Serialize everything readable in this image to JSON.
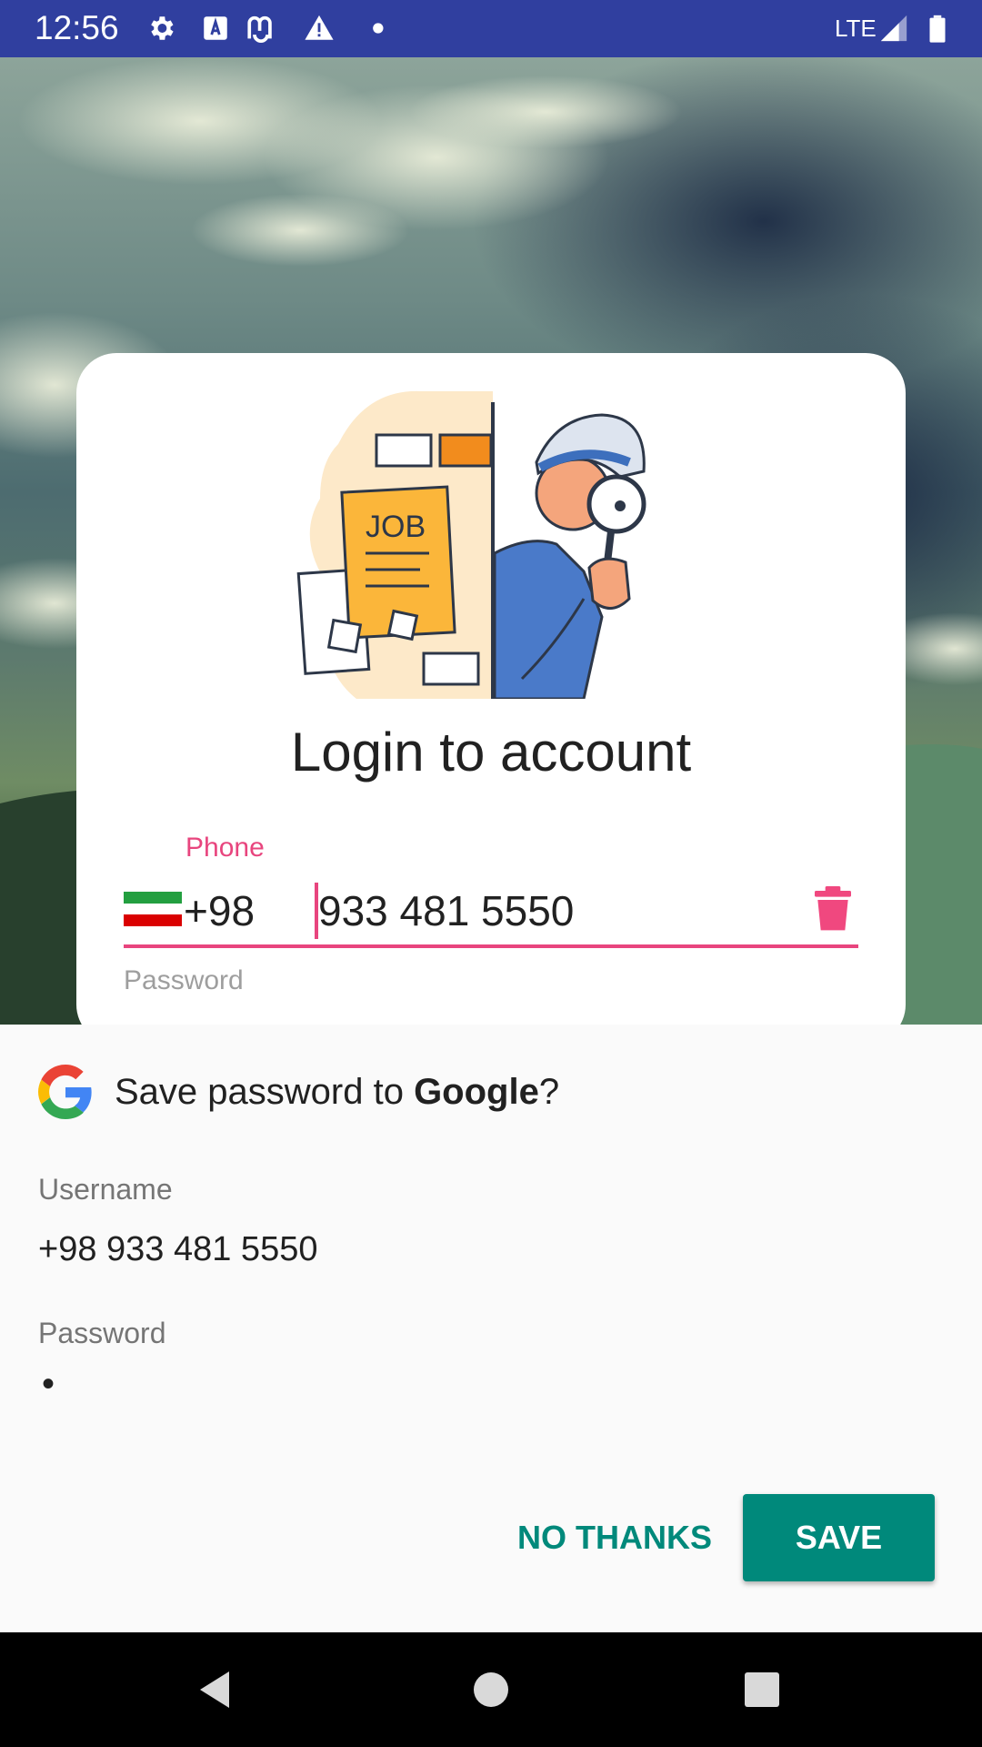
{
  "status_bar": {
    "time": "12:56",
    "network": "LTE",
    "icons": [
      "settings-icon",
      "a-box-icon",
      "m-app-icon",
      "warning-icon",
      "dot-icon",
      "signal-icon",
      "battery-icon"
    ],
    "background_color": "#303f9f"
  },
  "login": {
    "title": "Login to account",
    "phone_label": "Phone",
    "country_code": "+98",
    "phone_number": "933 481 5550",
    "password_label": "Password",
    "illustration_text": "JOB",
    "accent_color": "#e8457e",
    "flag_colors": [
      "#239f40",
      "#ffffff",
      "#da0000"
    ]
  },
  "save_sheet": {
    "title_prefix": "Save password to ",
    "title_brand": "Google",
    "title_suffix": "?",
    "username_label": "Username",
    "username_value": "+98 933 481 5550",
    "password_label": "Password",
    "password_value": "•",
    "no_thanks_label": "NO THANKS",
    "save_label": "SAVE",
    "accent_color": "#00897b"
  },
  "nav_bar": {
    "buttons": [
      "back-icon",
      "home-icon",
      "recents-icon"
    ]
  }
}
